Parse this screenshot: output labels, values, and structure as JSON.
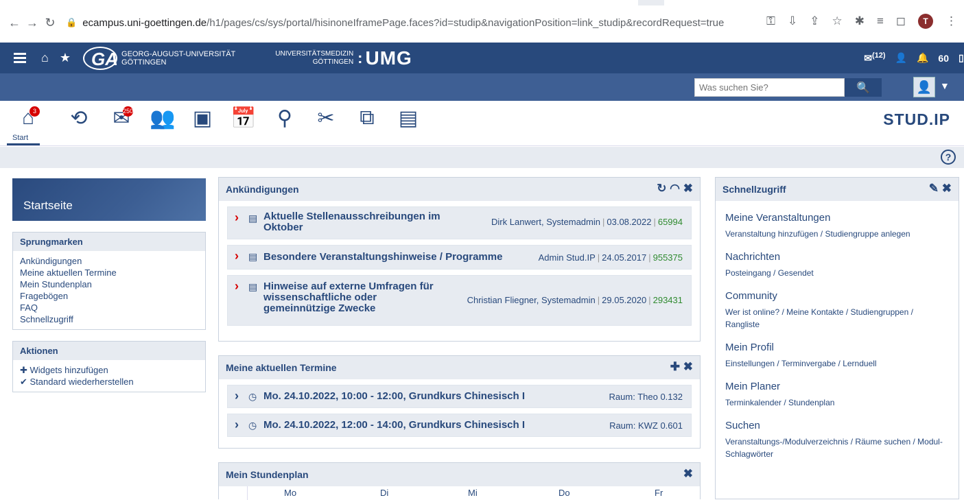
{
  "browser": {
    "url_host": "ecampus.uni-goettingen.de",
    "url_path": "/h1/pages/cs/sys/portal/hisinoneIframePage.faces?id=studip&navigationPosition=link_studip&recordRequest=true",
    "profile_initial": "T"
  },
  "topbar": {
    "uni_line1": "GEORG-AUGUST-UNIVERSITÄT",
    "uni_line2": "GÖTTINGEN",
    "umg_small1": "UNIVERSITÄTSMEDIZIN",
    "umg_small2": "GÖTTINGEN",
    "umg_big": "UMG",
    "mail_count": "(12)",
    "notification_count": "60"
  },
  "search": {
    "placeholder": "Was suchen Sie?"
  },
  "nav": {
    "start_label": "Start",
    "start_badge": "3",
    "messages_badge": "250",
    "brand": "STUD.IP"
  },
  "sidebar": {
    "title": "Startseite",
    "jump_title": "Sprungmarken",
    "jump_links": [
      "Ankündigungen",
      "Meine aktuellen Termine",
      "Mein Stundenplan",
      "Fragebögen",
      "FAQ",
      "Schnellzugriff"
    ],
    "actions_title": "Aktionen",
    "actions": [
      "Widgets hinzufügen",
      "Standard wiederherstellen"
    ]
  },
  "announcements": {
    "title": "Ankündigungen",
    "items": [
      {
        "title": "Aktuelle Stellenausschreibungen im Oktober",
        "author": "Dirk Lanwert, Systemadmin",
        "date": "03.08.2022",
        "views": "65994"
      },
      {
        "title": "Besondere Veranstaltungshinweise / Programme",
        "author": "Admin Stud.IP",
        "date": "24.05.2017",
        "views": "955375"
      },
      {
        "title": "Hinweise auf externe Umfragen für wissenschaftliche oder gemeinnützige Zwecke",
        "author": "Christian Fliegner, Systemadmin",
        "date": "29.05.2020",
        "views": "293431"
      }
    ]
  },
  "appointments": {
    "title": "Meine aktuellen Termine",
    "items": [
      {
        "title": "Mo. 24.10.2022, 10:00 - 12:00, Grundkurs Chinesisch I",
        "room": "Raum: Theo 0.132"
      },
      {
        "title": "Mo. 24.10.2022, 12:00 - 14:00, Grundkurs Chinesisch I",
        "room": "Raum: KWZ 0.601"
      }
    ]
  },
  "timetable": {
    "title": "Mein Stundenplan",
    "days": [
      "Mo",
      "Di",
      "Mi",
      "Do",
      "Fr"
    ]
  },
  "quick": {
    "title": "Schnellzugriff",
    "blocks": [
      {
        "title": "Meine Veranstaltungen",
        "sub": "Veranstaltung hinzufügen / Studiengruppe anlegen"
      },
      {
        "title": "Nachrichten",
        "sub": "Posteingang / Gesendet"
      },
      {
        "title": "Community",
        "sub": "Wer ist online? / Meine Kontakte / Studiengruppen / Rangliste"
      },
      {
        "title": "Mein Profil",
        "sub": "Einstellungen / Terminvergabe / Lernduell"
      },
      {
        "title": "Mein Planer",
        "sub": "Terminkalender / Stundenplan"
      },
      {
        "title": "Suchen",
        "sub": "Veranstaltungs-/Modulverzeichnis / Räume suchen / Modul-Schlagwörter"
      }
    ]
  }
}
